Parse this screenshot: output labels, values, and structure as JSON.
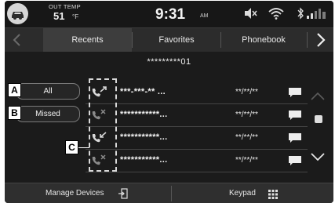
{
  "status_bar": {
    "temp_label": "OUT TEMP",
    "temp_value": "51",
    "temp_unit": "°F",
    "time": "9:31",
    "ampm": "AM"
  },
  "tabs": [
    {
      "label": "Recents",
      "active": true
    },
    {
      "label": "Favorites",
      "active": false
    },
    {
      "label": "Phonebook",
      "active": false
    }
  ],
  "device_number": "*********01",
  "filters": [
    {
      "label": "All"
    },
    {
      "label": "Missed"
    }
  ],
  "calls": [
    {
      "type": "outgoing",
      "name": "***-***-** ...",
      "time": "**/**/**"
    },
    {
      "type": "missed",
      "name": "***********...",
      "time": "**/**/**"
    },
    {
      "type": "incoming",
      "name": "***********...",
      "time": "**/**/**"
    },
    {
      "type": "missed",
      "name": "***********...",
      "time": "**/**/**"
    }
  ],
  "bottom": {
    "manage_devices": "Manage Devices",
    "keypad": "Keypad"
  },
  "callouts": {
    "a": "A",
    "b": "B",
    "c": "C"
  },
  "colors": {
    "panel": "#1b1b1b",
    "tab_active": "#3d3d3d",
    "text": "#f0f0f0"
  }
}
